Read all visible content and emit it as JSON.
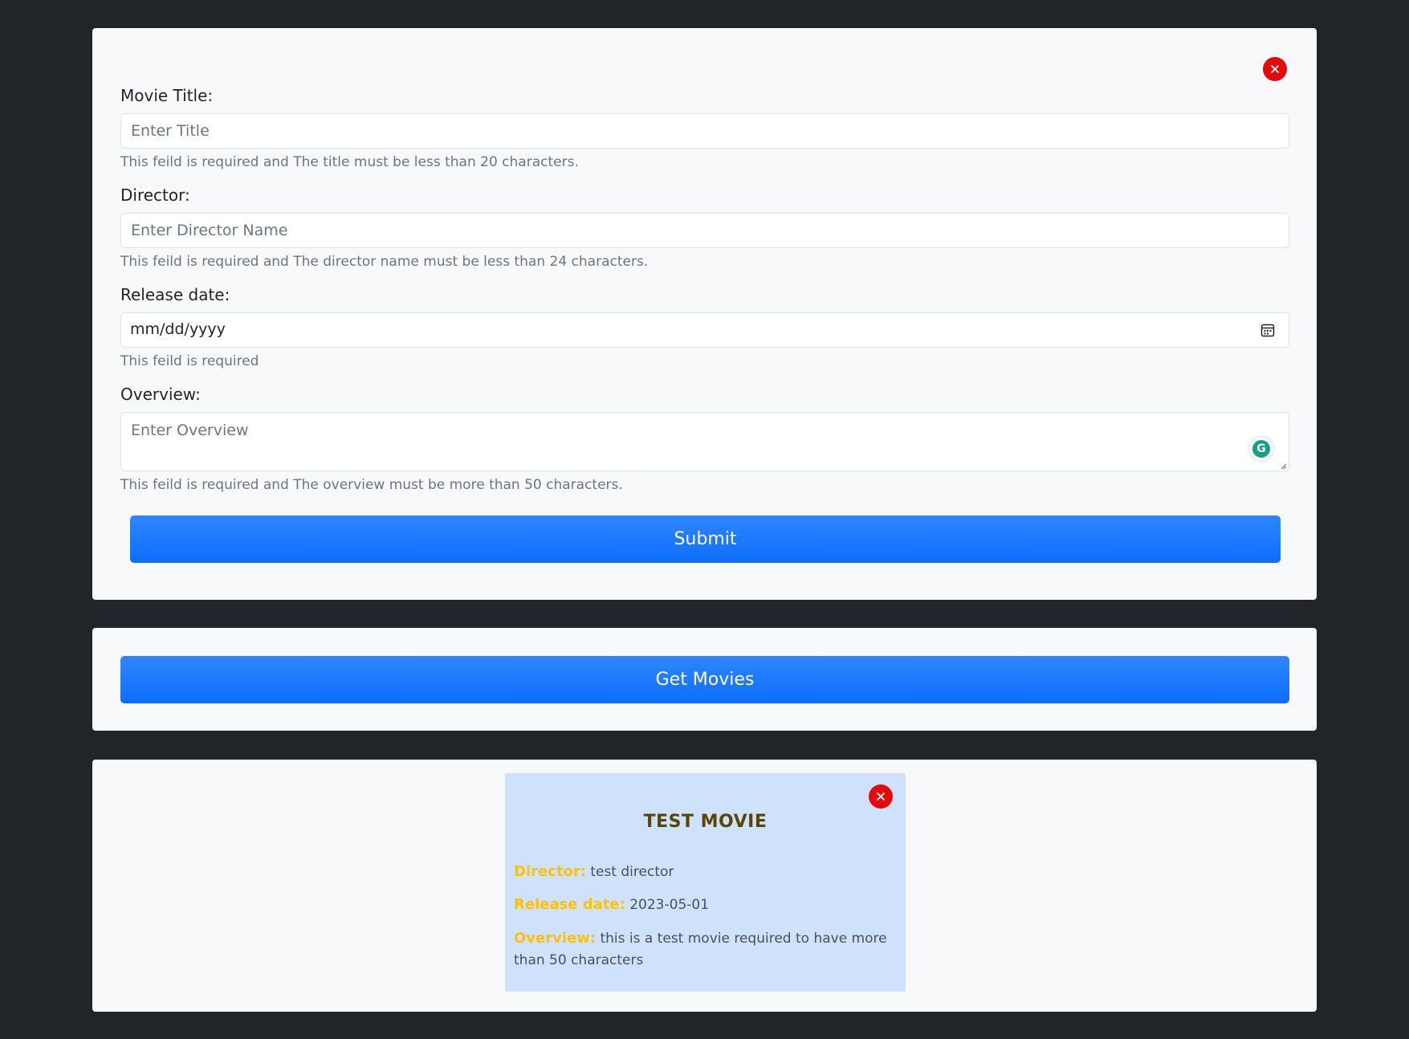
{
  "form": {
    "close_label": "×",
    "title_label": "Movie Title:",
    "title_placeholder": "Enter Title",
    "title_value": "",
    "title_help": "This feild is required and The title must be less than 20 characters.",
    "director_label": "Director:",
    "director_placeholder": "Enter Director Name",
    "director_value": "",
    "director_help": "This feild is required and The director name must be less than 24 characters.",
    "release_label": "Release date:",
    "release_value": "mm/dd/yyyy",
    "release_help": "This feild is required",
    "overview_label": "Overview:",
    "overview_placeholder": "Enter Overview",
    "overview_value": "",
    "overview_help": "This feild is required and The overview must be more than 50 characters.",
    "submit_label": "Submit"
  },
  "actions": {
    "get_movies_label": "Get Movies"
  },
  "movies": [
    {
      "title": "TEST MOVIE",
      "director_key": "Director:",
      "director": "test director",
      "release_key": "Release date:",
      "release_date": "2023-05-01",
      "overview_key": "Overview:",
      "overview": "this is a test movie required to have more than 50 characters"
    }
  ],
  "icons": {
    "close": "close-icon",
    "calendar": "calendar-icon",
    "grammarly": "grammarly-icon",
    "grammarly_glyph": "G",
    "resize": "resize-handle-icon"
  },
  "colors": {
    "page_bg": "#212529",
    "card_bg": "#f8f9fa",
    "primary": "#0d6efd",
    "danger": "#e30b0b",
    "movie_card_bg": "#cfe2fc",
    "movie_title": "#5a4508",
    "movie_key": "#ffc107"
  }
}
